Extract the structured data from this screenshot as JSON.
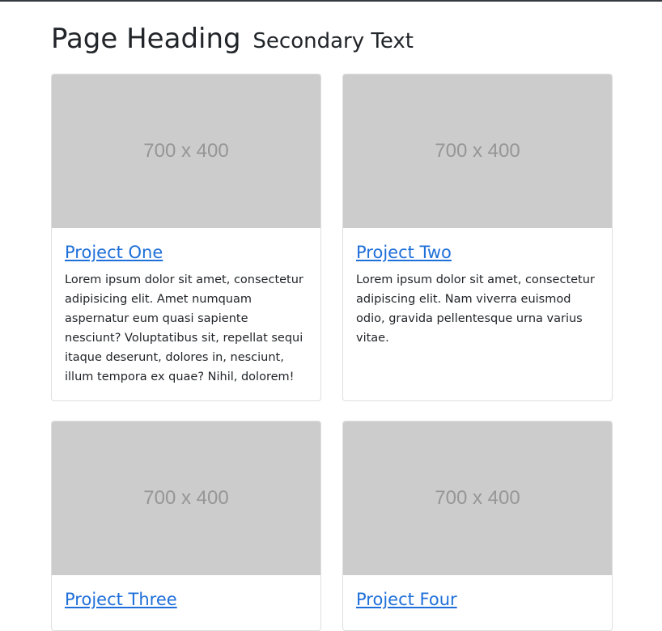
{
  "heading": {
    "main": "Page Heading",
    "secondary": "Secondary Text"
  },
  "projects": [
    {
      "image_text": "700 x 400",
      "title": "Project One",
      "text": "Lorem ipsum dolor sit amet, consectetur adipisicing elit. Amet numquam aspernatur eum quasi sapiente nesciunt? Voluptatibus sit, repellat sequi itaque deserunt, dolores in, nesciunt, illum tempora ex quae? Nihil, dolorem!"
    },
    {
      "image_text": "700 x 400",
      "title": "Project Two",
      "text": "Lorem ipsum dolor sit amet, consectetur adipiscing elit. Nam viverra euismod odio, gravida pellentesque urna varius vitae."
    },
    {
      "image_text": "700 x 400",
      "title": "Project Three",
      "text": ""
    },
    {
      "image_text": "700 x 400",
      "title": "Project Four",
      "text": ""
    }
  ],
  "colors": {
    "link": "#1e6fd9",
    "placeholder_bg": "#cccccc",
    "placeholder_text": "#969696",
    "topbar": "#343a40"
  }
}
